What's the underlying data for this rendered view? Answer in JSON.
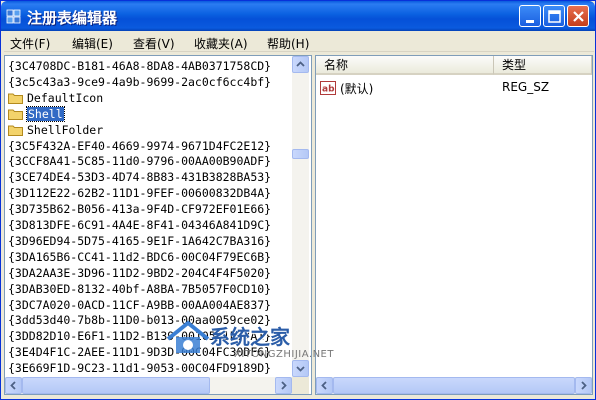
{
  "window": {
    "title": "注册表编辑器",
    "accent": "#0a5ade"
  },
  "menu": [
    {
      "label": "文件(F)"
    },
    {
      "label": "编辑(E)"
    },
    {
      "label": "查看(V)"
    },
    {
      "label": "收藏夹(A)"
    },
    {
      "label": "帮助(H)"
    }
  ],
  "tree": {
    "items": [
      {
        "label": "{3C4708DC-B181-46A8-8DA8-4AB0371758CD}",
        "type": "key"
      },
      {
        "label": "{3c5c43a3-9ce9-4a9b-9699-2ac0cf6cc4bf}",
        "type": "key"
      },
      {
        "label": "DefaultIcon",
        "type": "folder"
      },
      {
        "label": "Shell",
        "type": "folder",
        "selected": true
      },
      {
        "label": "ShellFolder",
        "type": "folder"
      },
      {
        "label": "{3C5F432A-EF40-4669-9974-9671D4FC2E12}",
        "type": "key"
      },
      {
        "label": "{3CCF8A41-5C85-11d0-9796-00AA00B90ADF}",
        "type": "key"
      },
      {
        "label": "{3CE74DE4-53D3-4D74-8B83-431B3828BA53}",
        "type": "key"
      },
      {
        "label": "{3D112E22-62B2-11D1-9FEF-00600832DB4A}",
        "type": "key"
      },
      {
        "label": "{3D735B62-B056-413a-9F4D-CF972EF01E66}",
        "type": "key"
      },
      {
        "label": "{3D813DFE-6C91-4A4E-8F41-04346A841D9C}",
        "type": "key"
      },
      {
        "label": "{3D96ED94-5D75-4165-9E1F-1A642C7BA316}",
        "type": "key"
      },
      {
        "label": "{3DA165B6-CC41-11d2-BDC6-00C04F79EC6B}",
        "type": "key"
      },
      {
        "label": "{3DA2AA3E-3D96-11D2-9BD2-204C4F4F5020}",
        "type": "key"
      },
      {
        "label": "{3DAB30ED-8132-40bf-A8BA-7B5057F0CD10}",
        "type": "key"
      },
      {
        "label": "{3DC7A020-0ACD-11CF-A9BB-00AA004AE837}",
        "type": "key"
      },
      {
        "label": "{3dd53d40-7b8b-11D0-b013-00aa0059ce02}",
        "type": "key"
      },
      {
        "label": "{3DD82D10-E6F1-11D2-B139-00105A1F77A1}",
        "type": "key"
      },
      {
        "label": "{3E4D4F1C-2AEE-11D1-9D3D-00C04FC30DF6}",
        "type": "key"
      },
      {
        "label": "{3E669F1D-9C23-11d1-9053-00C04FD9189D}",
        "type": "key"
      }
    ]
  },
  "list": {
    "columns": [
      {
        "label": "名称"
      },
      {
        "label": "类型"
      }
    ],
    "rows": [
      {
        "name": "(默认)",
        "type": "REG_SZ",
        "icon": "string-value-icon"
      }
    ]
  },
  "watermark": {
    "text": "系统之家",
    "url": "XITONGZHIJIA.NET"
  }
}
